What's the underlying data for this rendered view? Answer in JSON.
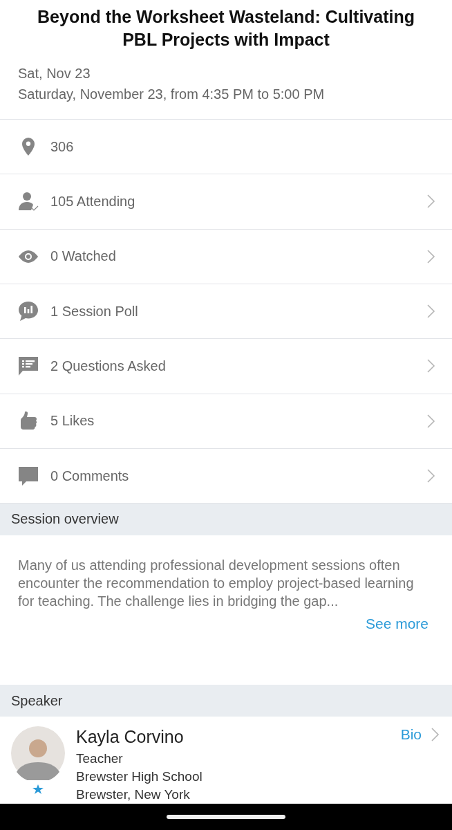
{
  "title": "Beyond the Worksheet Wasteland: Cultivating PBL Projects with Impact",
  "date_short": "Sat, Nov 23",
  "date_long": "Saturday, November 23, from 4:35 PM to 5:00 PM",
  "rows": [
    {
      "kind": "location",
      "label": "306",
      "chevron": false
    },
    {
      "kind": "attending",
      "label": "105 Attending",
      "chevron": true
    },
    {
      "kind": "watched",
      "label": "0 Watched",
      "chevron": true
    },
    {
      "kind": "poll",
      "label": "1 Session Poll",
      "chevron": true
    },
    {
      "kind": "questions",
      "label": "2 Questions Asked",
      "chevron": true
    },
    {
      "kind": "likes",
      "label": "5 Likes",
      "chevron": true
    },
    {
      "kind": "comments",
      "label": "0 Comments",
      "chevron": true
    }
  ],
  "overview": {
    "heading": "Session overview",
    "text": "Many of us attending professional development sessions often encounter the recommendation to employ project-based learning for teaching. The challenge lies in bridging the gap...",
    "see_more": "See more"
  },
  "speaker": {
    "heading": "Speaker",
    "name": "Kayla Corvino",
    "role": "Teacher",
    "organization": "Brewster High School",
    "location": "Brewster, New York",
    "bio": "Bio"
  }
}
